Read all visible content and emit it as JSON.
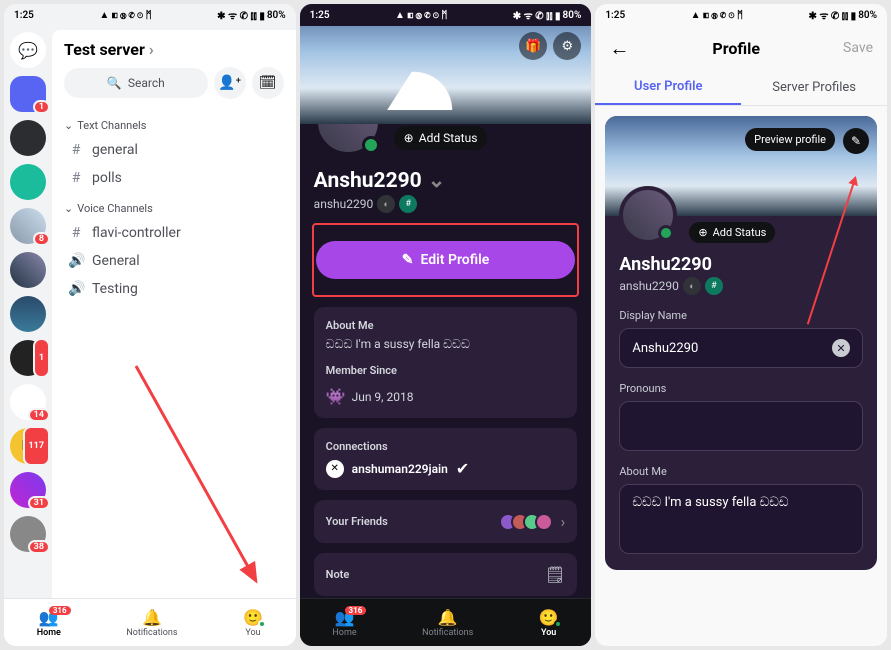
{
  "statusbar": {
    "time": "1:25",
    "battery": "80%"
  },
  "s1": {
    "serverTitle": "Test server",
    "searchPlaceholder": "Search",
    "textChannelsHeader": "Text Channels",
    "voiceChannelsHeader": "Voice Channels",
    "channels": {
      "text": [
        {
          "name": "general"
        },
        {
          "name": "polls"
        }
      ],
      "voice": [
        {
          "name": "flavi-controller",
          "icon": "hash"
        },
        {
          "name": "General",
          "icon": "speaker"
        },
        {
          "name": "Testing",
          "icon": "speaker"
        }
      ]
    },
    "railBadges": {
      "i1": "1",
      "i5": "8",
      "i8": "1",
      "i9": "14",
      "i10": "117",
      "i11": "31",
      "i12": "38"
    },
    "nav": {
      "home": "Home",
      "notifications": "Notifications",
      "you": "You",
      "homeBadge": "316"
    }
  },
  "s2": {
    "addStatus": "Add Status",
    "displayName": "Anshu2290",
    "username": "anshu2290",
    "editProfile": "Edit Profile",
    "aboutLabel": "About Me",
    "aboutText": "ඩඩඩ I'm a sussy fella ඩඩඩ",
    "memberSinceLabel": "Member Since",
    "memberSince": "Jun 9, 2018",
    "connectionsLabel": "Connections",
    "connectionName": "anshuman229jain",
    "friendsLabel": "Your Friends",
    "noteLabel": "Note",
    "nav": {
      "home": "Home",
      "notifications": "Notifications",
      "you": "You",
      "homeBadge": "316"
    }
  },
  "s3": {
    "title": "Profile",
    "save": "Save",
    "tabUser": "User Profile",
    "tabServer": "Server Profiles",
    "previewProfile": "Preview profile",
    "addStatus": "Add Status",
    "displayName": "Anshu2290",
    "username": "anshu2290",
    "displayNameLabel": "Display Name",
    "displayNameValue": "Anshu2290",
    "pronounsLabel": "Pronouns",
    "aboutLabel": "About Me",
    "aboutValue": "ඩඩඩ I'm a sussy fella ඩඩඩ"
  }
}
